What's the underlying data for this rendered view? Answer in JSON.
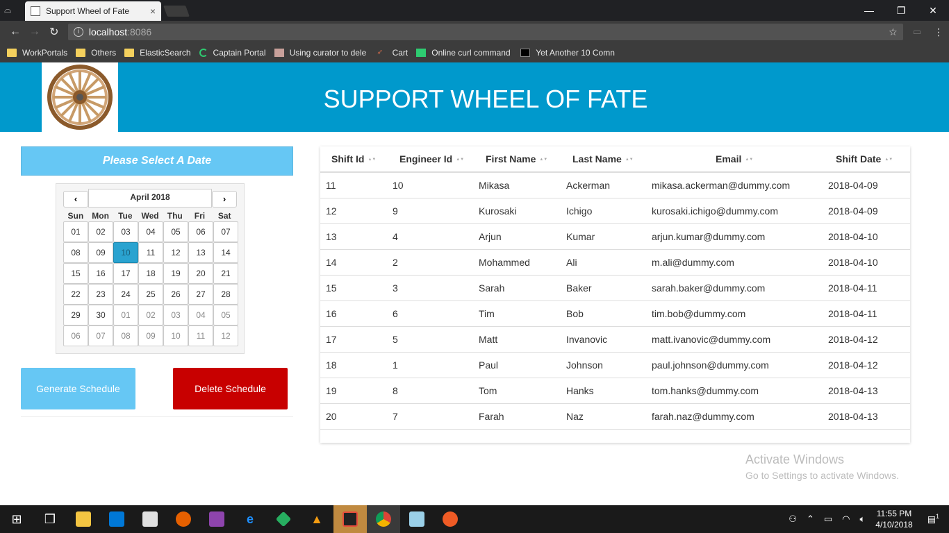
{
  "browser": {
    "tab_title": "Support Wheel of Fate",
    "tab_close": "×",
    "url_host": "localhost",
    "url_port": ":8086",
    "bookmarks": [
      {
        "label": "WorkPortals",
        "icon": "folder"
      },
      {
        "label": "Others",
        "icon": "folder"
      },
      {
        "label": "ElasticSearch",
        "icon": "folder"
      },
      {
        "label": "Captain Portal",
        "icon": "spin"
      },
      {
        "label": "Using curator to dele",
        "icon": "face"
      },
      {
        "label": "Cart",
        "icon": "cart"
      },
      {
        "label": "Online curl command",
        "icon": "green"
      },
      {
        "label": "Yet Another 10 Comn",
        "icon": "blk"
      }
    ]
  },
  "app": {
    "title": "SUPPORT WHEEL OF FATE",
    "logo_icon": "wagon-wheel-icon"
  },
  "datepicker": {
    "header": "Please Select A Date",
    "prev": "‹",
    "next": "›",
    "month": "April 2018",
    "weekdays": [
      "Sun",
      "Mon",
      "Tue",
      "Wed",
      "Thu",
      "Fri",
      "Sat"
    ],
    "days": [
      [
        "01",
        "02",
        "03",
        "04",
        "05",
        "06",
        "07"
      ],
      [
        "08",
        "09",
        "10",
        "11",
        "12",
        "13",
        "14"
      ],
      [
        "15",
        "16",
        "17",
        "18",
        "19",
        "20",
        "21"
      ],
      [
        "22",
        "23",
        "24",
        "25",
        "26",
        "27",
        "28"
      ],
      [
        "29",
        "30",
        "01",
        "02",
        "03",
        "04",
        "05"
      ],
      [
        "06",
        "07",
        "08",
        "09",
        "10",
        "11",
        "12"
      ]
    ],
    "selected": "10"
  },
  "buttons": {
    "generate": "Generate Schedule",
    "delete": "Delete Schedule"
  },
  "table": {
    "columns": [
      "Shift Id",
      "Engineer Id",
      "First Name",
      "Last Name",
      "Email",
      "Shift Date"
    ],
    "rows": [
      [
        "11",
        "10",
        "Mikasa",
        "Ackerman",
        "mikasa.ackerman@dummy.com",
        "2018-04-09"
      ],
      [
        "12",
        "9",
        "Kurosaki",
        "Ichigo",
        "kurosaki.ichigo@dummy.com",
        "2018-04-09"
      ],
      [
        "13",
        "4",
        "Arjun",
        "Kumar",
        "arjun.kumar@dummy.com",
        "2018-04-10"
      ],
      [
        "14",
        "2",
        "Mohammed",
        "Ali",
        "m.ali@dummy.com",
        "2018-04-10"
      ],
      [
        "15",
        "3",
        "Sarah",
        "Baker",
        "sarah.baker@dummy.com",
        "2018-04-11"
      ],
      [
        "16",
        "6",
        "Tim",
        "Bob",
        "tim.bob@dummy.com",
        "2018-04-11"
      ],
      [
        "17",
        "5",
        "Matt",
        "Invanovic",
        "matt.ivanovic@dummy.com",
        "2018-04-12"
      ],
      [
        "18",
        "1",
        "Paul",
        "Johnson",
        "paul.johnson@dummy.com",
        "2018-04-12"
      ],
      [
        "19",
        "8",
        "Tom",
        "Hanks",
        "tom.hanks@dummy.com",
        "2018-04-13"
      ],
      [
        "20",
        "7",
        "Farah",
        "Naz",
        "farah.naz@dummy.com",
        "2018-04-13"
      ]
    ]
  },
  "watermark": {
    "line1": "Activate Windows",
    "line2": "Go to Settings to activate Windows."
  },
  "taskbar": {
    "time": "11:55 PM",
    "date": "4/10/2018",
    "notifications": "1"
  },
  "colors": {
    "header_bg": "#0099cc",
    "accent_light": "#66c7f4",
    "danger": "#c80000"
  }
}
